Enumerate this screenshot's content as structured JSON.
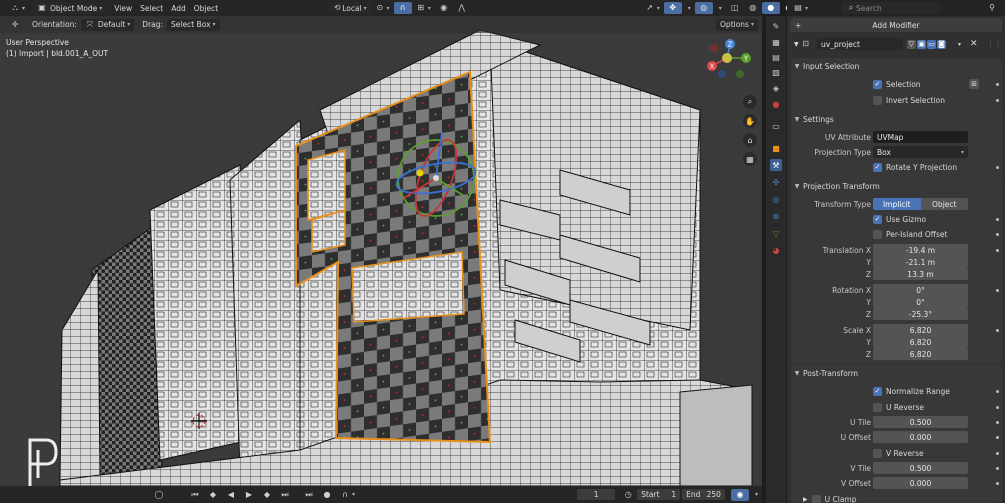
{
  "header": {
    "mode": "Object Mode",
    "menus": [
      "View",
      "Select",
      "Add",
      "Object"
    ],
    "transform_orientation": "Local"
  },
  "toolbar2": {
    "orientation_label": "Orientation:",
    "orientation_value": "Default",
    "drag_label": "Drag:",
    "drag_value": "Select Box",
    "options_label": "Options"
  },
  "viewport": {
    "view_name": "User Perspective",
    "object_name": "(1) Import | bld.001_A_OUT",
    "gizmo_axes": [
      "X",
      "Y",
      "Z"
    ]
  },
  "timeline": {
    "current_frame": "1",
    "start_label": "Start",
    "start_value": "1",
    "end_label": "End",
    "end_value": "250"
  },
  "properties": {
    "search_placeholder": "Search",
    "add_modifier": "Add Modifier",
    "modifier_name": "uv_project",
    "panels": {
      "input_selection": "Input Selection",
      "settings": "Settings",
      "projection_transform": "Projection Transform",
      "post_transform": "Post-Transform",
      "u_clamp": "U Clamp"
    },
    "selection": {
      "label": "Selection",
      "checked": true
    },
    "invert_selection": {
      "label": "Invert Selection",
      "checked": false
    },
    "uv_attribute": {
      "label": "UV Attribute",
      "value": "UVMap"
    },
    "projection_type": {
      "label": "Projection Type",
      "value": "Box"
    },
    "rotate_y": {
      "label": "Rotate Y Projection",
      "checked": true
    },
    "transform_type": {
      "label": "Transform Type",
      "options": [
        "Implicit",
        "Object"
      ],
      "selected": "Implicit"
    },
    "use_gizmo": {
      "label": "Use Gizmo",
      "checked": true
    },
    "per_island": {
      "label": "Per-Island Offset",
      "checked": false
    },
    "translation": {
      "label_x": "Translation X",
      "x": "-19.4 m",
      "y": "-21.1 m",
      "z": "13.3 m"
    },
    "rotation": {
      "label_x": "Rotation X",
      "x": "0°",
      "y": "0°",
      "z": "-25.3°"
    },
    "scale": {
      "label_x": "Scale X",
      "x": "6.820",
      "y": "6.820",
      "z": "6.820"
    },
    "axis_y": "Y",
    "axis_z": "Z",
    "normalize_range": {
      "label": "Normalize Range",
      "checked": true
    },
    "u_reverse": {
      "label": "U Reverse",
      "checked": false
    },
    "u_tile": {
      "label": "U Tile",
      "value": "0.500"
    },
    "u_offset": {
      "label": "U Offset",
      "value": "0.000"
    },
    "v_reverse": {
      "label": "V Reverse",
      "checked": false
    },
    "v_tile": {
      "label": "V Tile",
      "value": "0.500"
    },
    "v_offset": {
      "label": "V Offset",
      "value": "0.000"
    }
  },
  "colors": {
    "selection_orange": "#e8901a",
    "accent_blue": "#4a72b6",
    "checker_dark": "#2e2e2e",
    "checker_light": "#7a7a7a",
    "background": "#3a3a3a"
  }
}
